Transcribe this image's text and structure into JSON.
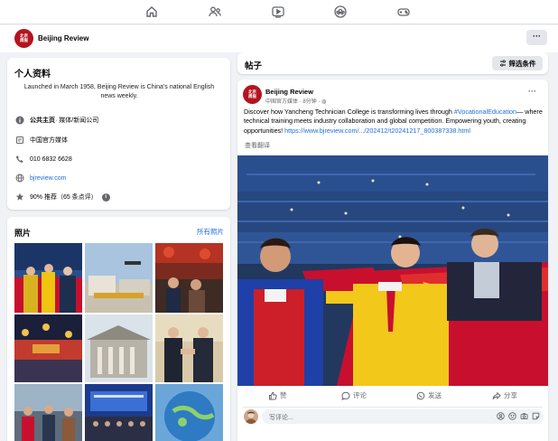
{
  "top_nav": {
    "icons": [
      "home-icon",
      "friends-icon",
      "video-icon",
      "groups-icon",
      "gaming-icon"
    ]
  },
  "page_header": {
    "name": "Beijing Review",
    "avatar_text": "北京周报",
    "more_label": "···"
  },
  "intro": {
    "title": "个人资料",
    "description": "Launched in March 1958, Beijing Review is China's national English news weekly.",
    "category_prefix": "公共主页",
    "category_value": " · 媒体/新闻公司",
    "label": "中国官方媒体",
    "phone": "010 6832 6628",
    "website": "bjreview.com",
    "rating": "90% 推荐（65 条点评）",
    "rating_info": "i"
  },
  "photos": {
    "title": "照片",
    "see_all": "所有照片"
  },
  "posts_bar": {
    "title": "帖子",
    "filter_label": "筛选条件"
  },
  "post": {
    "author": "Beijing Review",
    "meta": "中国官方媒体 · 8分钟 · ◍",
    "more_label": "···",
    "text_before": "Discover how Yancheng Technician College is transforming lives through ",
    "hashtag": "#VocationalEducation",
    "text_after": "— where technical training meets industry collaboration and global competition. Empowering youth, creating opportunities! ",
    "url": "https://www.bjreview.com/.../202412/t20241217_800387338.html",
    "translate": "查看翻译",
    "actions": {
      "like": "赞",
      "comment": "评论",
      "send": "发送",
      "share": "分享"
    },
    "comment_placeholder": "写评论..."
  },
  "colors": {
    "brand_red": "#b4141f",
    "link_blue": "#216fdb",
    "page_bg": "#f0f2f5"
  }
}
